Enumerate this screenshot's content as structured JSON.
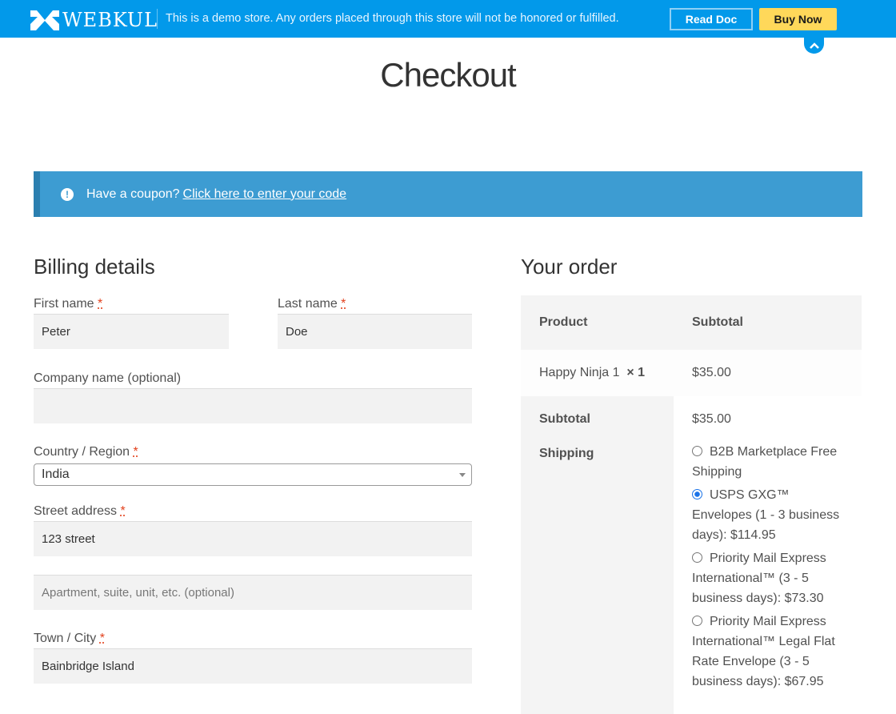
{
  "topbar": {
    "brand": "WEBKUL",
    "notice": "This is a demo store. Any orders placed through this store will not be honored or fulfilled.",
    "read_doc": "Read Doc",
    "buy_now": "Buy Now",
    "colors": {
      "bar": "#0299ea",
      "buy": "#ffd85a"
    }
  },
  "page_title": "Checkout",
  "coupon": {
    "text": "Have a coupon?",
    "link": "Click here to enter your code"
  },
  "billing": {
    "title": "Billing details",
    "required_mark": "*",
    "first_name": {
      "label": "First name",
      "value": "Peter"
    },
    "last_name": {
      "label": "Last name",
      "value": "Doe"
    },
    "company": {
      "label": "Company name (optional)",
      "value": ""
    },
    "country": {
      "label": "Country / Region",
      "value": "India"
    },
    "street": {
      "label": "Street address",
      "value": "123 street",
      "placeholder2": "Apartment, suite, unit, etc. (optional)"
    },
    "city": {
      "label": "Town / City",
      "value": "Bainbridge Island"
    }
  },
  "order": {
    "title": "Your order",
    "col_product": "Product",
    "col_subtotal": "Subtotal",
    "item": {
      "name": "Happy Ninja 1",
      "qty": "× 1",
      "price": "$35.00"
    },
    "subtotal_label": "Subtotal",
    "subtotal_value": "$35.00",
    "shipping_label": "Shipping",
    "shipping_options": [
      {
        "label": "B2B Marketplace Free Shipping",
        "selected": false
      },
      {
        "label": "USPS GXG™ Envelopes (1 - 3 business days): $114.95",
        "selected": true
      },
      {
        "label": "Priority Mail Express International™ (3 - 5 business days): $73.30",
        "selected": false
      },
      {
        "label": "Priority Mail Express International™ Legal Flat Rate Envelope (3 - 5 business days): $67.95",
        "selected": false
      }
    ]
  }
}
